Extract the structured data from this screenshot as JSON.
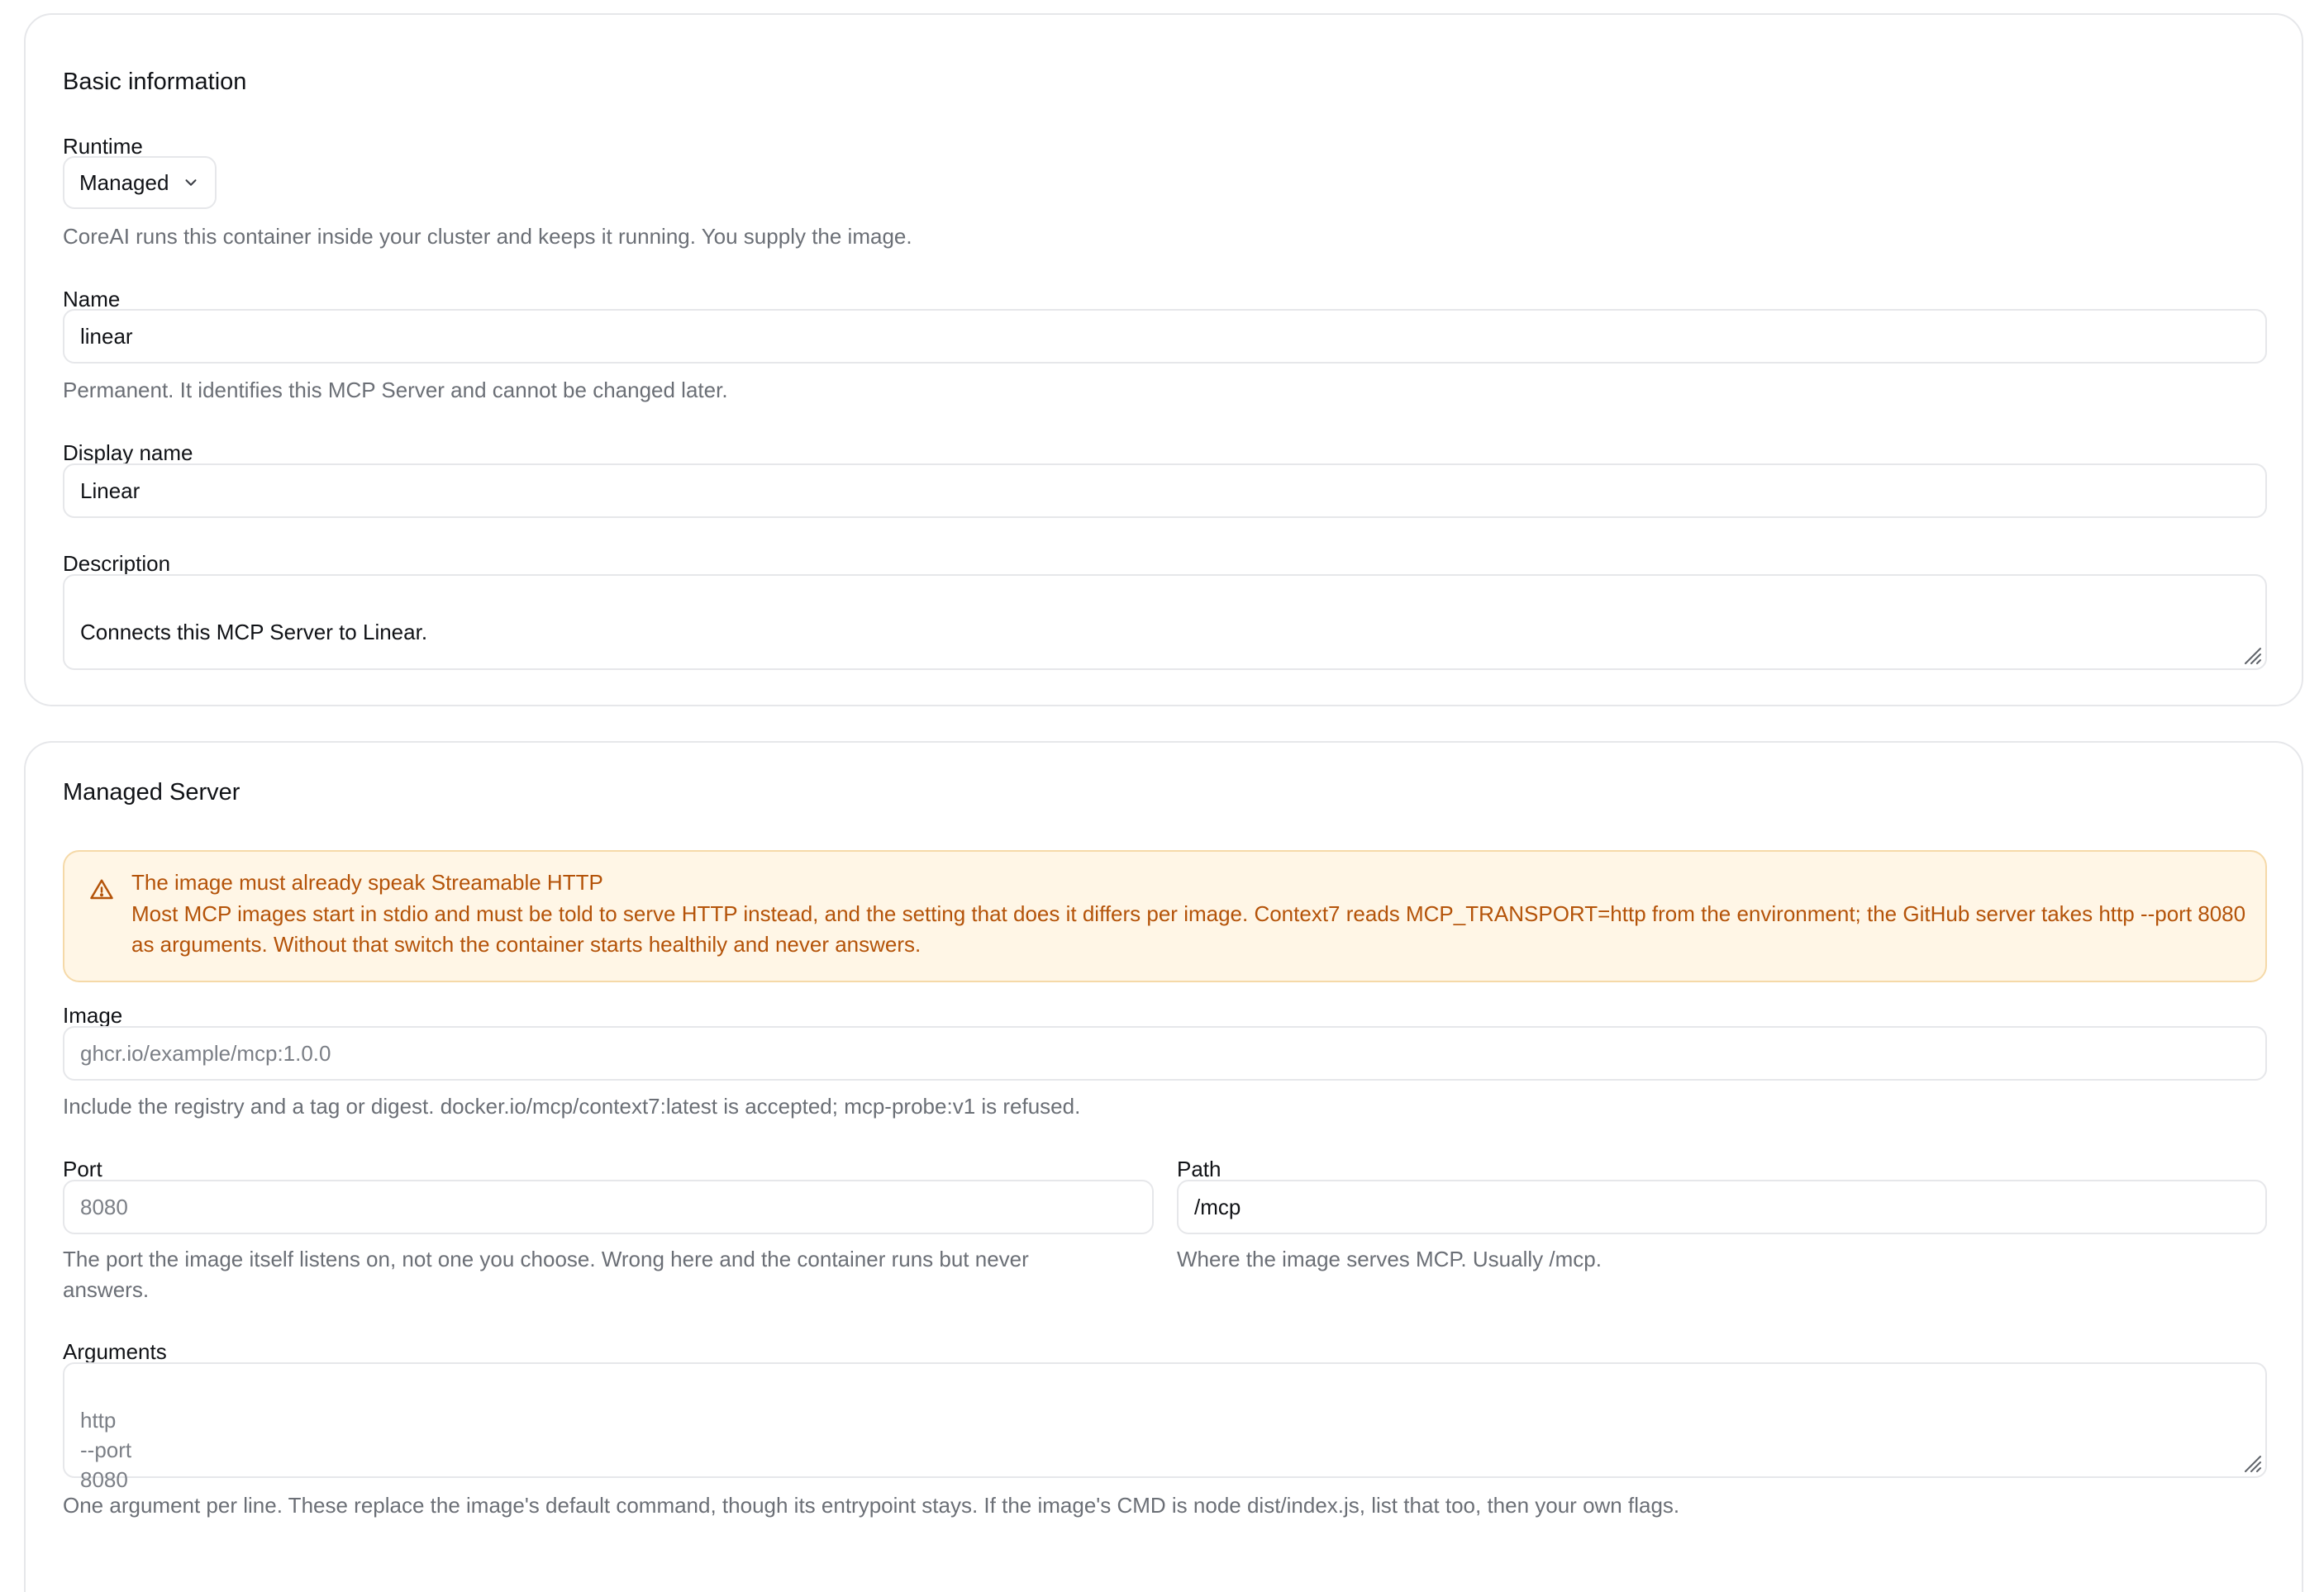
{
  "basic": {
    "title": "Basic information",
    "runtime_label": "Runtime",
    "runtime_value": "Managed",
    "runtime_help": "CoreAI runs this container inside your cluster and keeps it running. You supply the image.",
    "name_label": "Name",
    "name_value": "linear",
    "name_help": "Permanent. It identifies this MCP Server and cannot be changed later.",
    "display_name_label": "Display name",
    "display_name_value": "Linear",
    "description_label": "Description",
    "description_value": "Connects this MCP Server to Linear."
  },
  "managed": {
    "title": "Managed Server",
    "alert": {
      "title": "The image must already speak Streamable HTTP",
      "body": "Most MCP images start in stdio and must be told to serve HTTP instead, and the setting that does it differs per image. Context7 reads MCP_TRANSPORT=http from the environment; the GitHub server takes http --port 8080 as arguments. Without that switch the container starts healthily and never answers.",
      "color": "#b45309",
      "background": "#fff6e6"
    },
    "image_label": "Image",
    "image_placeholder": "ghcr.io/example/mcp:1.0.0",
    "image_help": "Include the registry and a tag or digest. docker.io/mcp/context7:latest is accepted; mcp-probe:v1 is refused.",
    "port_label": "Port",
    "port_placeholder": "8080",
    "port_help": "The port the image itself listens on, not one you choose. Wrong here and the container runs but never answers.",
    "path_label": "Path",
    "path_value": "/mcp",
    "path_help": "Where the image serves MCP. Usually /mcp.",
    "arguments_label": "Arguments",
    "arguments_placeholder": "http\n--port\n8080",
    "arguments_help": "One argument per line. These replace the image's default command, though its entrypoint stays. If the image's CMD is node dist/index.js, list that too, then your own flags."
  },
  "icons": {
    "runtime_select": "chevron-down-icon",
    "alert": "warning-triangle-icon",
    "textarea_resize": "resize-grip-icon"
  }
}
